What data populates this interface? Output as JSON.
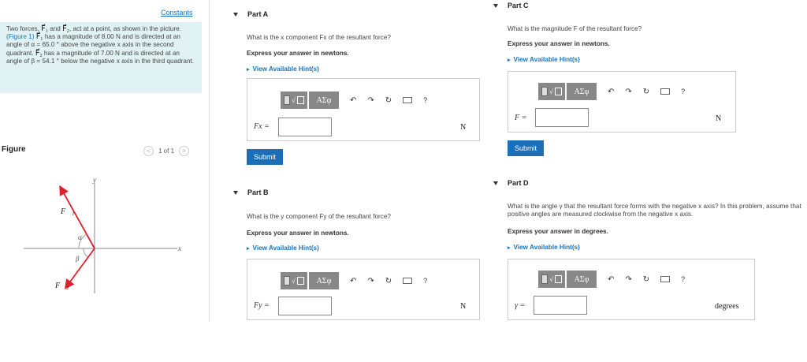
{
  "problem": {
    "constants_link": "Constants",
    "t1": "Two forces, ",
    "f1": "F⃗₁",
    "t2": " and ",
    "f2": "F⃗₂",
    "t3": ", act at a point, as shown in the picture. ",
    "fig_link": "(Figure 1)",
    "t4": " has a magnitude of 8.00 N and is directed at an angle of α = 65.0 ° above the negative x axis in the second quadrant. ",
    "t5": " has a magnitude of 7.00 N and is directed at an angle of β = 54.1 ° below the negative x axis in the third quadrant."
  },
  "figure": {
    "label": "Figure",
    "pager": "1 of 1",
    "prev": "<",
    "next": ">",
    "axis_x": "x",
    "axis_y": "y",
    "alpha": "α",
    "beta": "β",
    "f1": "F⃗₁",
    "f2": "F⃗₂"
  },
  "toolbar": {
    "root": "√",
    "greek": "AΣφ",
    "undo": "↶",
    "redo": "↷",
    "reset": "↻",
    "help": "?"
  },
  "parts": {
    "a": {
      "title": "Part A",
      "question": "What is the x component Fx of the resultant force?",
      "express": "Express your answer in newtons.",
      "hint": "View Available Hint(s)",
      "label": "Fx =",
      "unit": "N",
      "submit": "Submit",
      "value": ""
    },
    "b": {
      "title": "Part B",
      "question": "What is the y component Fy of the resultant force?",
      "express": "Express your answer in newtons.",
      "hint": "View Available Hint(s)",
      "label": "Fy =",
      "unit": "N",
      "value": ""
    },
    "c": {
      "title": "Part C",
      "question": "What is the magnitude F of the resultant force?",
      "express": "Express your answer in newtons.",
      "hint": "View Available Hint(s)",
      "label": "F =",
      "unit": "N",
      "submit": "Submit",
      "value": ""
    },
    "d": {
      "title": "Part D",
      "question": "What is the angle γ that the resultant force forms with the negative x axis? In this problem, assume that positive angles are measured clockwise from the negative x axis.",
      "express": "Express your answer in degrees.",
      "hint": "View Available Hint(s)",
      "label": "γ =",
      "unit": "degrees",
      "value": ""
    }
  }
}
